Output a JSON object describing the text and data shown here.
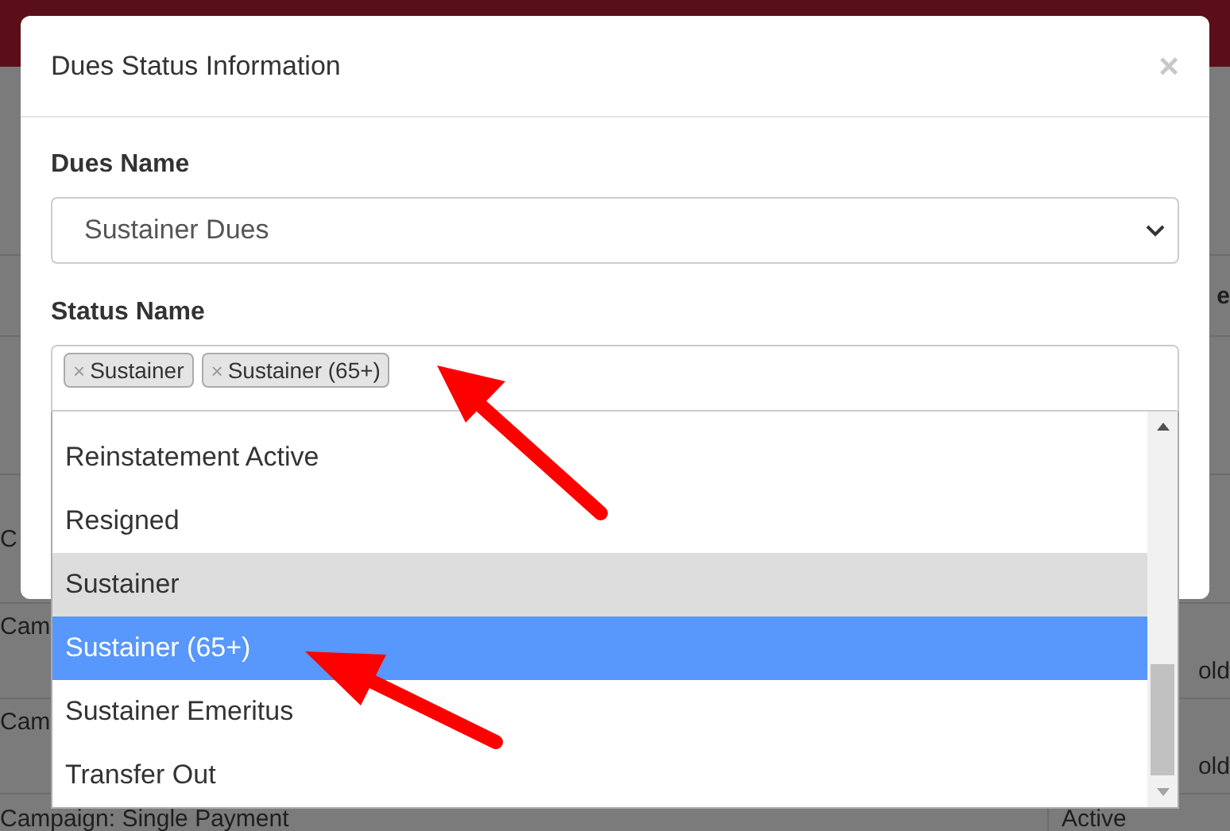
{
  "background_table": {
    "header": {
      "column_2": "e"
    },
    "rows": [
      {
        "column_1": "C"
      },
      {
        "column_1": "Cam",
        "column_2": "old"
      },
      {
        "column_1": "Cam",
        "column_2": "old"
      },
      {
        "column_1": "Campaign: Single Payment",
        "column_2": "Active"
      }
    ]
  },
  "dialog": {
    "title": "Dues Status Information",
    "close": "×",
    "dues_name": {
      "label": "Dues Name",
      "value": "Sustainer Dues"
    },
    "status_name": {
      "label": "Status Name",
      "tags": [
        {
          "remove": "×",
          "label": "Sustainer"
        },
        {
          "remove": "×",
          "label": "Sustainer (65+)"
        }
      ],
      "options": [
        {
          "label": "Reinstatement Active",
          "selected": false,
          "highlighted": false
        },
        {
          "label": "Resigned",
          "selected": false,
          "highlighted": false
        },
        {
          "label": "Sustainer",
          "selected": true,
          "highlighted": false
        },
        {
          "label": "Sustainer (65+)",
          "selected": true,
          "highlighted": true
        },
        {
          "label": "Sustainer Emeritus",
          "selected": false,
          "highlighted": false
        },
        {
          "label": "Transfer Out",
          "selected": false,
          "highlighted": false
        }
      ]
    }
  }
}
